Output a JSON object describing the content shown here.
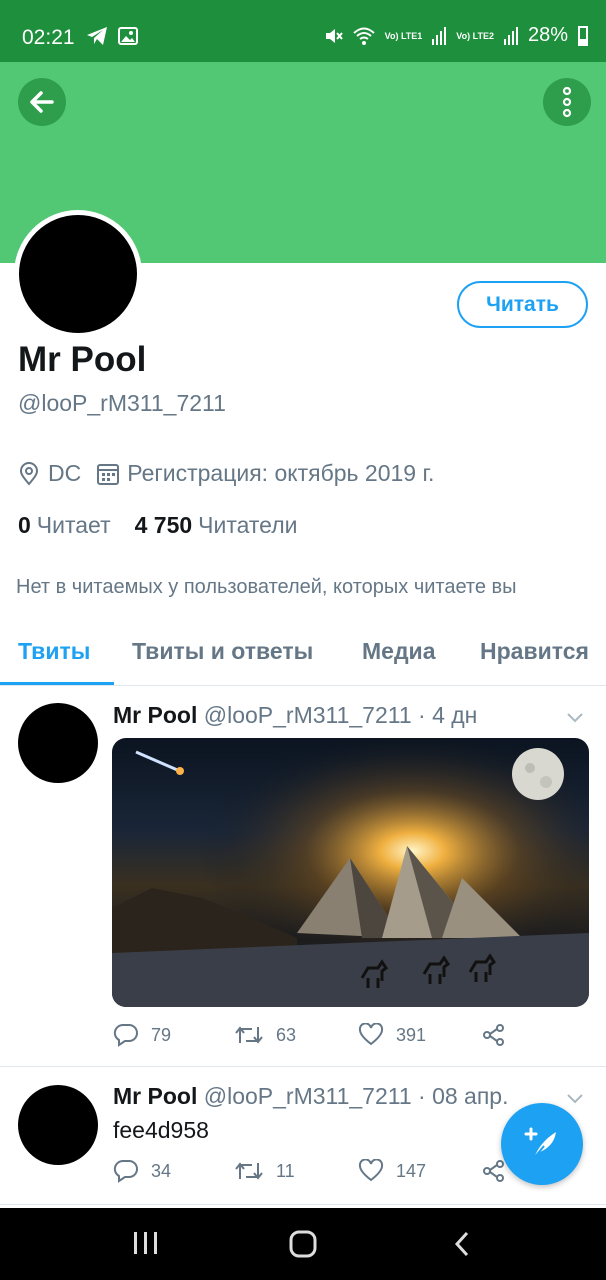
{
  "status_bar": {
    "time": "02:21",
    "net1": "Vo) LTE1",
    "net2": "Vo) LTE2",
    "battery": "28%"
  },
  "profile": {
    "follow_label": "Читать",
    "name": "Mr Pool",
    "handle": "@looP_rM311_7211",
    "location": "DC",
    "registration": "Регистрация: октябрь 2019 г.",
    "following_count": "0",
    "following_label": "Читает",
    "followers_count": "4 750",
    "followers_label": "Читатели",
    "followed_note": "Нет в читаемых у пользователей, которых читаете вы"
  },
  "tabs": [
    "Твиты",
    "Твиты и ответы",
    "Медиа",
    "Нравится"
  ],
  "tweets": [
    {
      "name": "Mr Pool",
      "handle_time": "@looP_rM311_7211 · 4 дн",
      "replies": "79",
      "retweets": "63",
      "likes": "391"
    },
    {
      "name": "Mr Pool",
      "handle_time": "@looP_rM311_7211 · 08 апр.",
      "text": "fee4d958",
      "replies": "34",
      "retweets": "11",
      "likes": "147"
    }
  ],
  "colors": {
    "status_bar": "#1e8f3c",
    "banner": "#52c774",
    "accent": "#1da1f2",
    "secondary_text": "#657786"
  }
}
